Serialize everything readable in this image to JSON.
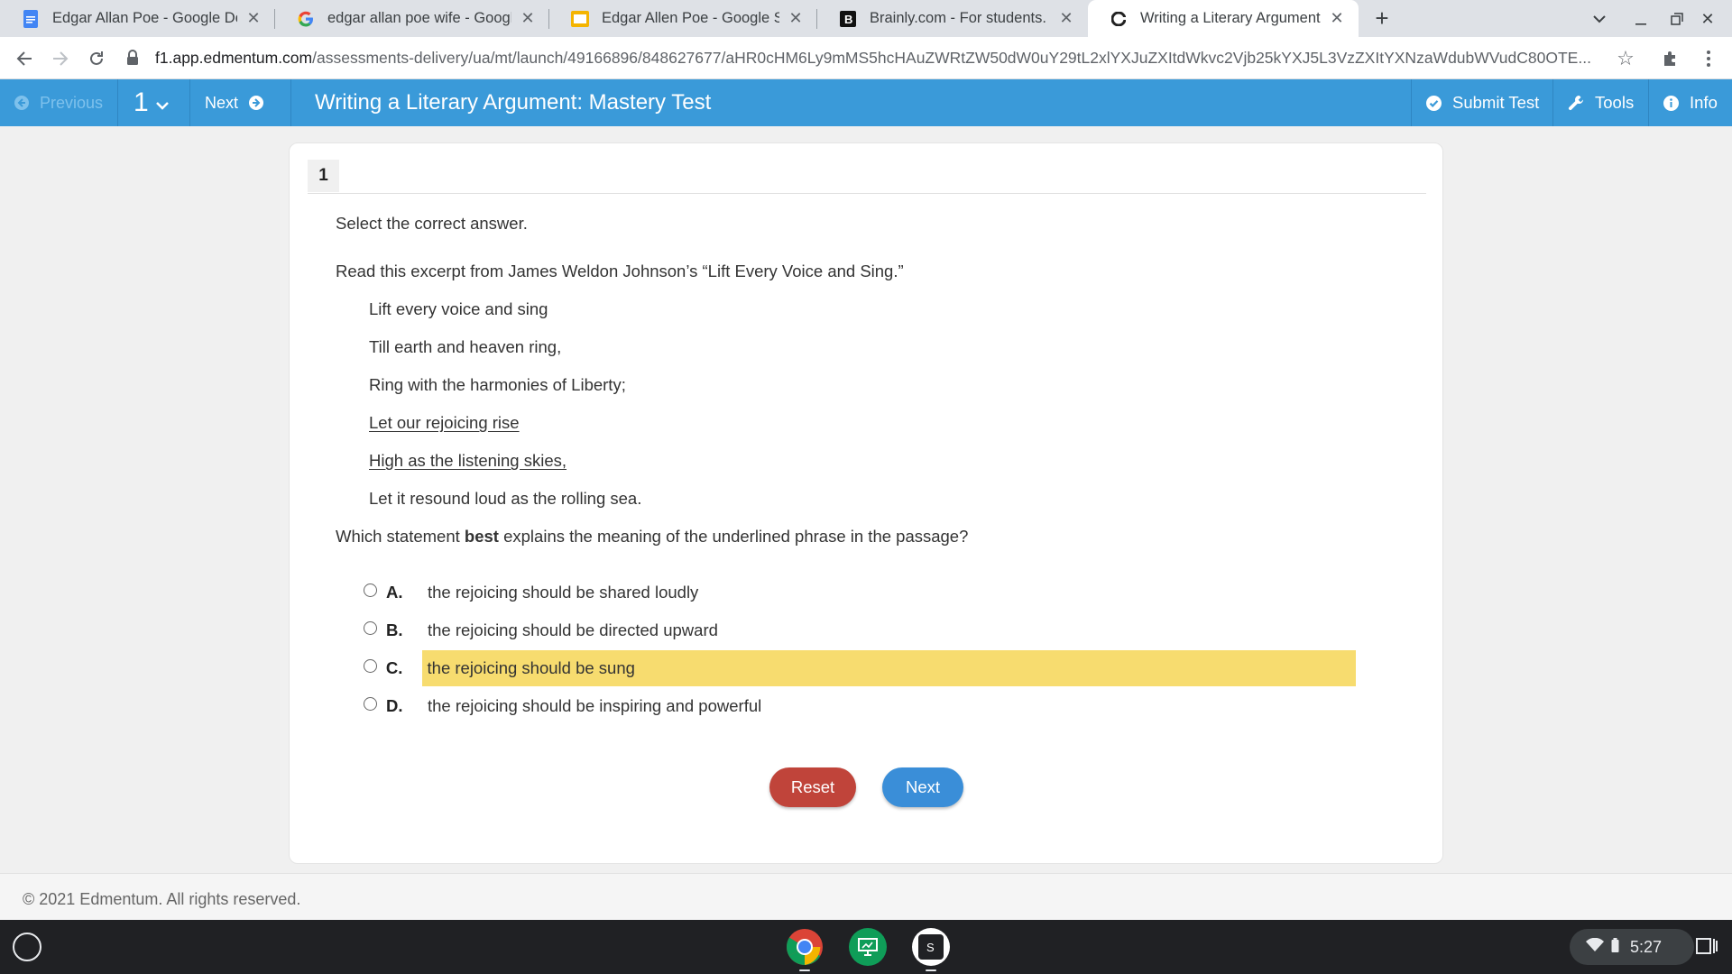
{
  "browser": {
    "tabs": [
      {
        "title": "Edgar Allan Poe - Google Docs",
        "icon": "google-docs-icon"
      },
      {
        "title": "edgar allan poe wife - Google Search",
        "icon": "google-icon"
      },
      {
        "title": "Edgar Allen Poe - Google Slides",
        "icon": "google-slides-icon"
      },
      {
        "title": "Brainly.com - For students. By students.",
        "icon": "brainly-icon"
      },
      {
        "title": "Writing a Literary Argument: Mastery Test",
        "icon": "edmentum-icon"
      }
    ],
    "url_host": "f1.app.edmentum.com",
    "url_path": "/assessments-delivery/ua/mt/launch/49166896/848627677/aHR0cHM6Ly9mMS5hcHAuZWRtZW50dW0uY29tL2xlYXJuZXItdWkvc2Vjb25kYXJ5L3VzZXItYXNzaWdubWVudC80OTE..."
  },
  "header": {
    "previous_label": "Previous",
    "question_number": "1",
    "next_label": "Next",
    "title": "Writing a Literary Argument: Mastery Test",
    "submit_label": "Submit Test",
    "tools_label": "Tools",
    "info_label": "Info"
  },
  "question": {
    "tab_number": "1",
    "instruction": "Select the correct answer.",
    "intro": "Read this excerpt from James Weldon Johnson’s “Lift Every Voice and Sing.”",
    "poem_lines": [
      "Lift every voice and sing",
      "Till earth and heaven ring,",
      "Ring with the harmonies of Liberty;",
      "Let our rejoicing rise",
      "High as the listening skies,",
      "Let it resound loud as the rolling sea."
    ],
    "prompt_before": "Which statement ",
    "prompt_bold": "best",
    "prompt_after": " explains the meaning of the underlined phrase in the passage?",
    "options": [
      {
        "letter": "A.",
        "text": "the rejoicing should be shared loudly"
      },
      {
        "letter": "B.",
        "text": "the rejoicing should be directed upward"
      },
      {
        "letter": "C.",
        "text": "the rejoicing should be sung"
      },
      {
        "letter": "D.",
        "text": "the rejoicing should be inspiring and powerful"
      }
    ],
    "highlighted_option": "C.",
    "highlight_color": "#f7dc6f"
  },
  "actions": {
    "reset_label": "Reset",
    "next_label": "Next"
  },
  "footer": {
    "copyright": "© 2021 Edmentum. All rights reserved."
  },
  "taskbar": {
    "time": "5:27",
    "apps": [
      "chrome-icon",
      "classroom-screen-icon",
      "s-app-icon"
    ]
  },
  "colors": {
    "header_blue": "#3a9ad9",
    "reset_red": "#c0443a",
    "next_blue": "#3a8ed8"
  }
}
